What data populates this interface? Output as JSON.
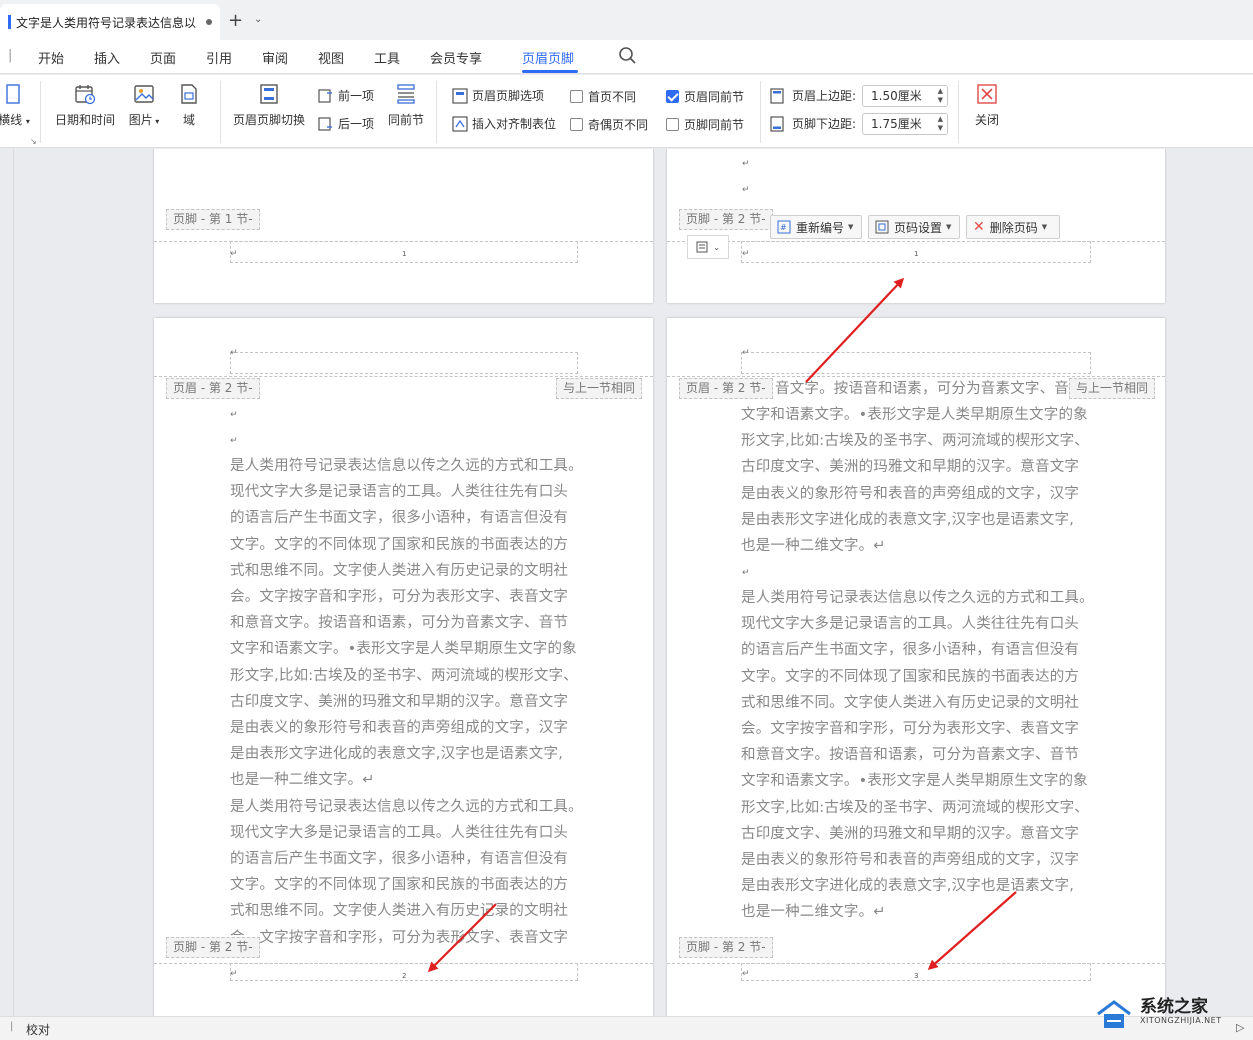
{
  "window": {
    "tab_title": "文字是人类用符号记录表达信息以",
    "new_tab_label": "+"
  },
  "menu": {
    "items": [
      "开始",
      "插入",
      "页面",
      "引用",
      "审阅",
      "视图",
      "工具",
      "会员专享",
      "页眉页脚"
    ],
    "active": "页眉页脚"
  },
  "ribbon": {
    "partial_left_label": "横线",
    "datetime": "日期和时间",
    "picture": "图片",
    "field": "域",
    "hf_switch": "页眉页脚切换",
    "prev": "前一项",
    "next": "后一项",
    "same_as_prev": "同前节",
    "hf_options": "页眉页脚选项",
    "insert_align_tab": "插入对齐制表位",
    "first_page_diff": "首页不同",
    "odd_even_diff": "奇偶页不同",
    "header_same_prev": "页眉同前节",
    "footer_same_prev": "页脚同前节",
    "header_top_margin_label": "页眉上边距:",
    "header_top_margin_value": "1.50厘米",
    "footer_bottom_margin_label": "页脚下边距:",
    "footer_bottom_margin_value": "1.75厘米",
    "close": "关闭",
    "checks": {
      "first_page_diff": false,
      "odd_even_diff": false,
      "header_same_prev": true,
      "footer_same_prev": false
    }
  },
  "pages": {
    "p1_footer_tag": "页脚 - 第 1 节-",
    "p1_page_num": "1",
    "p2_footer_tag": "页脚 - 第 2 节-",
    "p2_page_num": "1",
    "p3_header_tag": "页眉 - 第 2 节-",
    "p3_same_prev": "与上一节相同",
    "p3_footer_tag": "页脚 - 第 2 节-",
    "p3_page_num": "2",
    "p4_header_tag": "页眉 - 第 2 节-",
    "p4_same_prev": "与上一节相同",
    "p4_footer_tag": "页脚 - 第 2 节-",
    "p4_page_num": "3"
  },
  "footer_toolbar": {
    "renumber": "重新编号",
    "page_num_settings": "页码设置",
    "delete_page_num": "删除页码"
  },
  "body_text": {
    "p3": "是人类用符号记录表达信息以传之久远的方式和工具。\n现代文字大多是记录语言的工具。人类往往先有口头\n的语言后产生书面文字，很多小语种，有语言但没有\n文字。文字的不同体现了国家和民族的书面表达的方\n式和思维不同。文字使人类进入有历史记录的文明社\n会。文字按字音和字形，可分为表形文字、表音文字\n和意音文字。按语音和语素，可分为音素文字、音节\n文字和语素文字。•表形文字是人类早期原生文字的象\n形文字,比如:古埃及的圣书字、两河流域的楔形文字、\n古印度文字、美洲的玛雅文和早期的汉字。意音文字\n是由表义的象形符号和表音的声旁组成的文字，汉字\n是由表形文字进化成的表意文字,汉字也是语素文字,\n也是一种二维文字。↵\n是人类用符号记录表达信息以传之久远的方式和工具。\n现代文字大多是记录语言的工具。人类往往先有口头\n的语言后产生书面文字，很多小语种，有语言但没有\n文字。文字的不同体现了国家和民族的书面表达的方\n式和思维不同。文字使人类进入有历史记录的文明社\n会。文字按字音和字形，可分为表形文字、表音文字",
    "p4_first_line": "音文字。按语音和语素，可分为音素文字、音",
    "p4": "文字和语素文字。•表形文字是人类早期原生文字的象\n形文字,比如:古埃及的圣书字、两河流域的楔形文字、\n古印度文字、美洲的玛雅文和早期的汉字。意音文字\n是由表义的象形符号和表音的声旁组成的文字，汉字\n是由表形文字进化成的表意文字,汉字也是语素文字,\n也是一种二维文字。↵",
    "p4b": "是人类用符号记录表达信息以传之久远的方式和工具。\n现代文字大多是记录语言的工具。人类往往先有口头\n的语言后产生书面文字，很多小语种，有语言但没有\n文字。文字的不同体现了国家和民族的书面表达的方\n式和思维不同。文字使人类进入有历史记录的文明社\n会。文字按字音和字形，可分为表形文字、表音文字\n和意音文字。按语音和语素，可分为音素文字、音节\n文字和语素文字。•表形文字是人类早期原生文字的象\n形文字,比如:古埃及的圣书字、两河流域的楔形文字、\n古印度文字、美洲的玛雅文和早期的汉字。意音文字\n是由表义的象形符号和表音的声旁组成的文字，汉字\n是由表形文字进化成的表意文字,汉字也是语素文字,\n也是一种二维文字。↵"
  },
  "status": {
    "proofread": "校对"
  },
  "watermark": {
    "text": "系统之家",
    "url": "XITONGZHIJIA.NET"
  },
  "colors": {
    "accent": "#2f6cf6",
    "annotation_arrow": "#e02020"
  }
}
